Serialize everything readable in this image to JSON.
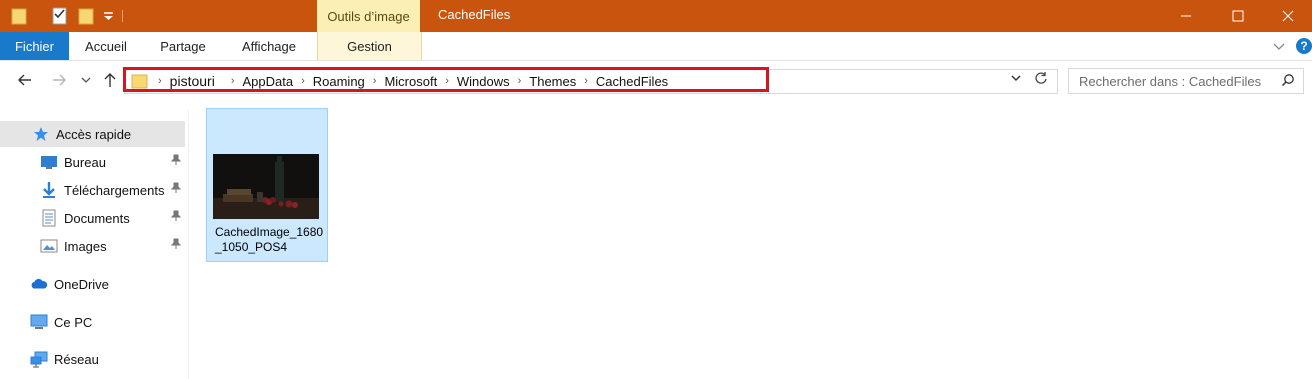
{
  "titlebar": {
    "context_tab_label": "Outils d’image",
    "window_title": "CachedFiles",
    "accent": "#c9540d"
  },
  "ribbon": {
    "tabs": [
      {
        "label": "Fichier"
      },
      {
        "label": "Accueil"
      },
      {
        "label": "Partage"
      },
      {
        "label": "Affichage"
      },
      {
        "label": "Gestion"
      }
    ]
  },
  "address": {
    "crumbs": [
      "pistouri",
      "AppData",
      "Roaming",
      "Microsoft",
      "Windows",
      "Themes",
      "CachedFiles"
    ]
  },
  "search": {
    "placeholder": "Rechercher dans : CachedFiles"
  },
  "sidebar": {
    "items": [
      {
        "label": "Accès rapide",
        "icon": "star-icon"
      },
      {
        "label": "Bureau",
        "icon": "desktop-icon",
        "pinned": true
      },
      {
        "label": "Téléchargements",
        "icon": "download-icon",
        "pinned": true
      },
      {
        "label": "Documents",
        "icon": "documents-icon",
        "pinned": true
      },
      {
        "label": "Images",
        "icon": "pictures-icon",
        "pinned": true
      },
      {
        "label": "OneDrive",
        "icon": "onedrive-icon"
      },
      {
        "label": "Ce PC",
        "icon": "computer-icon"
      },
      {
        "label": "Réseau",
        "icon": "network-icon"
      }
    ]
  },
  "files": [
    {
      "name": "CachedImage_1680_1050_POS4"
    }
  ]
}
